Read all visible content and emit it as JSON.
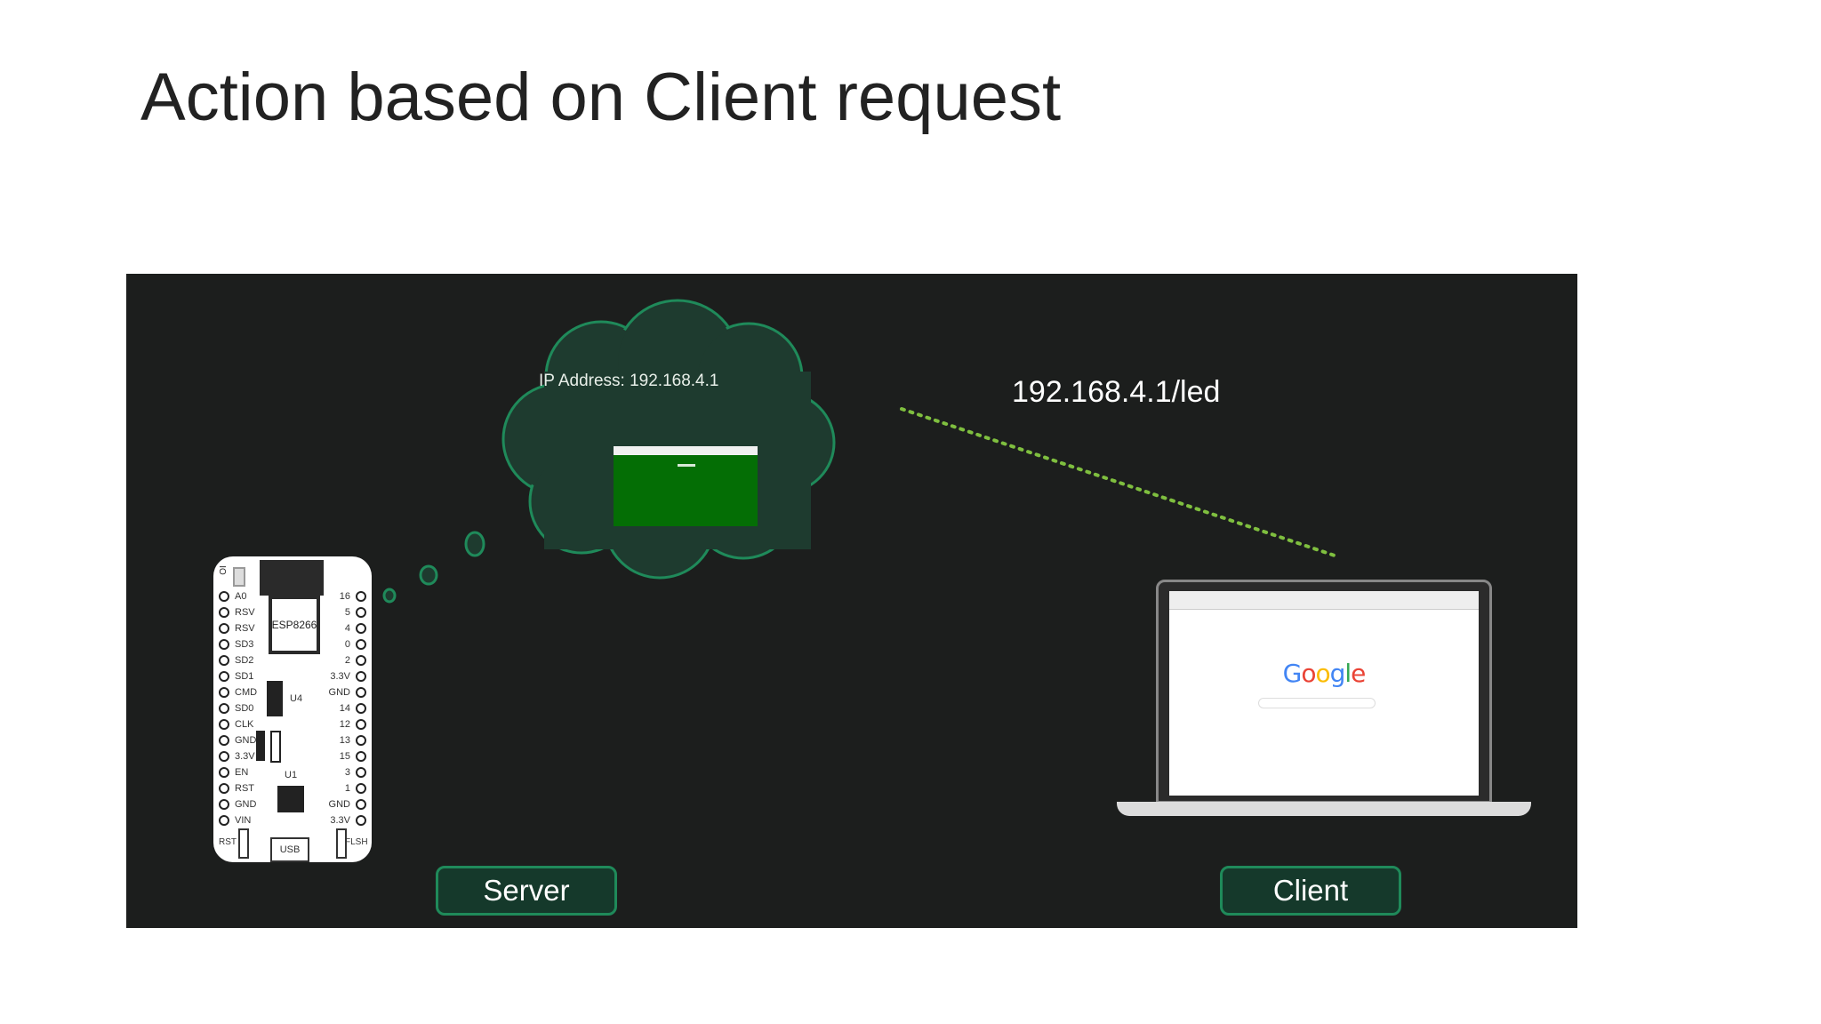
{
  "slide": {
    "title": "Action based on Client request"
  },
  "diagram": {
    "ip_address_label": "IP Address: 192.168.4.1",
    "request_url": "192.168.4.1/led",
    "server_label": "Server",
    "client_label": "Client"
  },
  "board": {
    "module_label": "ESP8266",
    "io_label": "IO",
    "u4_label": "U4",
    "u1_label": "U1",
    "usb_label": "USB",
    "rst_label": "RST",
    "flsh_label": "FLSH",
    "left_pins": [
      "A0",
      "RSV",
      "RSV",
      "SD3",
      "SD2",
      "SD1",
      "CMD",
      "SD0",
      "CLK",
      "GND",
      "3.3V",
      "EN",
      "RST",
      "GND",
      "VIN"
    ],
    "right_pins": [
      "16",
      "5",
      "4",
      "0",
      "2",
      "3.3V",
      "GND",
      "14",
      "12",
      "13",
      "15",
      "3",
      "1",
      "GND",
      "3.3V"
    ]
  },
  "laptop": {
    "google_wordmark": "Google"
  },
  "colors": {
    "panel_bg": "#1c1e1d",
    "cloud_fill": "#1e3b2f",
    "cloud_stroke": "#1f8a5a",
    "dotted_line": "#7fbf3f",
    "mini_browser": "#046e05"
  }
}
